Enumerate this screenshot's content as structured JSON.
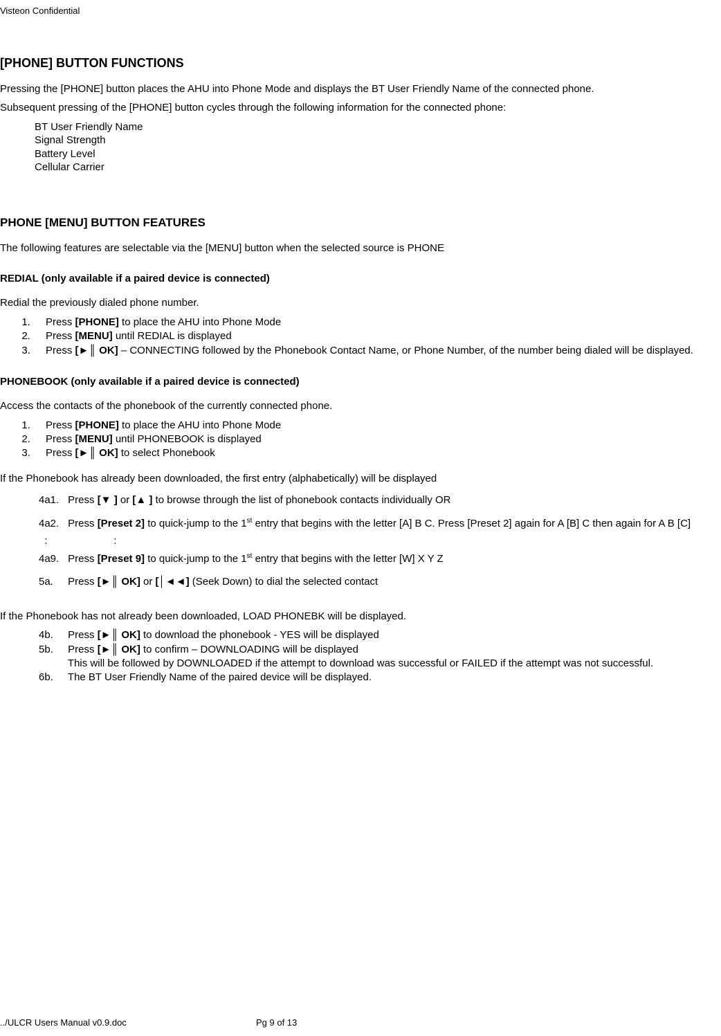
{
  "header": {
    "confidential": "Visteon Confidential"
  },
  "s1": {
    "title": "[PHONE] BUTTON FUNCTIONS",
    "p1": "Pressing the [PHONE] button places the AHU into Phone Mode and displays the BT User Friendly Name of the connected phone.",
    "p2": "Subsequent pressing of the [PHONE] button cycles through the following information for the connected phone:",
    "items": {
      "i1": "BT User Friendly Name",
      "i2": "Signal Strength",
      "i3": "Battery Level",
      "i4": "Cellular Carrier"
    }
  },
  "s2": {
    "title": "PHONE [MENU] BUTTON FEATURES",
    "intro": "The following features are selectable via the [MENU] button when the selected source is PHONE"
  },
  "redial": {
    "title": "REDIAL (only available if a paired device is connected)",
    "intro": "Redial the previously dialed phone number.",
    "steps": {
      "s1a": "Press ",
      "s1b": "[PHONE]",
      "s1c": " to place the AHU into Phone Mode",
      "s2a": "Press ",
      "s2b": "[MENU]",
      "s2c": " until REDIAL is displayed",
      "s3a": "Press ",
      "s3b": "[►║ OK]",
      "s3c": " – CONNECTING followed by the Phonebook Contact Name, or Phone Number, of the number being dialed will be displayed."
    }
  },
  "pb": {
    "title": "PHONEBOOK (only available if a paired device is connected)",
    "intro": "Access the contacts of the phonebook of the currently connected phone.",
    "steps": {
      "s1a": "Press ",
      "s1b": "[PHONE]",
      "s1c": " to place the AHU into Phone Mode",
      "s2a": "Press ",
      "s2b": "[MENU]",
      "s2c": " until PHONEBOOK is displayed",
      "s3a": "Press ",
      "s3b": "[►║ OK]",
      "s3c": " to select Phonebook"
    },
    "dl_yes": "If the Phonebook has already been downloaded, the first entry (alphabetically) will be displayed",
    "a1": {
      "no": "4a1.",
      "pre": "Press ",
      "b1": "[▼ ]",
      "mid": " or ",
      "b2": "[▲ ]",
      "post": " to browse through the list of phonebook contacts individually OR"
    },
    "a2": {
      "no": "4a2.",
      "pre": "Press ",
      "b1": "[Preset 2]",
      "mid1": " to quick-jump to the 1",
      "sup": "st",
      "mid2": " entry that begins with the letter [A] B C.  Press [Preset 2] again for A [B] C then again for A B [C]"
    },
    "colon": "  :                       :",
    "a9": {
      "no": "4a9.",
      "pre": "Press ",
      "b1": "[Preset 9]",
      "mid1": " to quick-jump to the 1",
      "sup": "st",
      "mid2": " entry that begins with the letter [W] X Y Z"
    },
    "a5": {
      "no": "5a.",
      "pre": "Press ",
      "b1": "[►║ OK]",
      "mid": " or ",
      "b2": "[│◄◄]",
      "post": " (Seek Down) to dial the selected contact"
    },
    "dl_no": "If the Phonebook has not already been downloaded, LOAD PHONEBK will be displayed.",
    "b4": {
      "no": "4b.",
      "pre": "Press ",
      "b1": "[►║ OK]",
      "post": " to download the phonebook - YES will be displayed"
    },
    "b5": {
      "no": "5b.",
      "pre": "Press ",
      "b1": "[►║ OK]",
      "post": " to confirm – DOWNLOADING will be displayed"
    },
    "b5note": "This will be followed by DOWNLOADED if the attempt to download was successful or FAILED if the attempt was not successful.",
    "b6": {
      "no": "6b.",
      "txt": "The BT User Friendly Name of the paired device will be displayed."
    }
  },
  "footer": {
    "left": "../ULCR Users Manual v0.9.doc",
    "mid": "Pg 9 of 13"
  }
}
